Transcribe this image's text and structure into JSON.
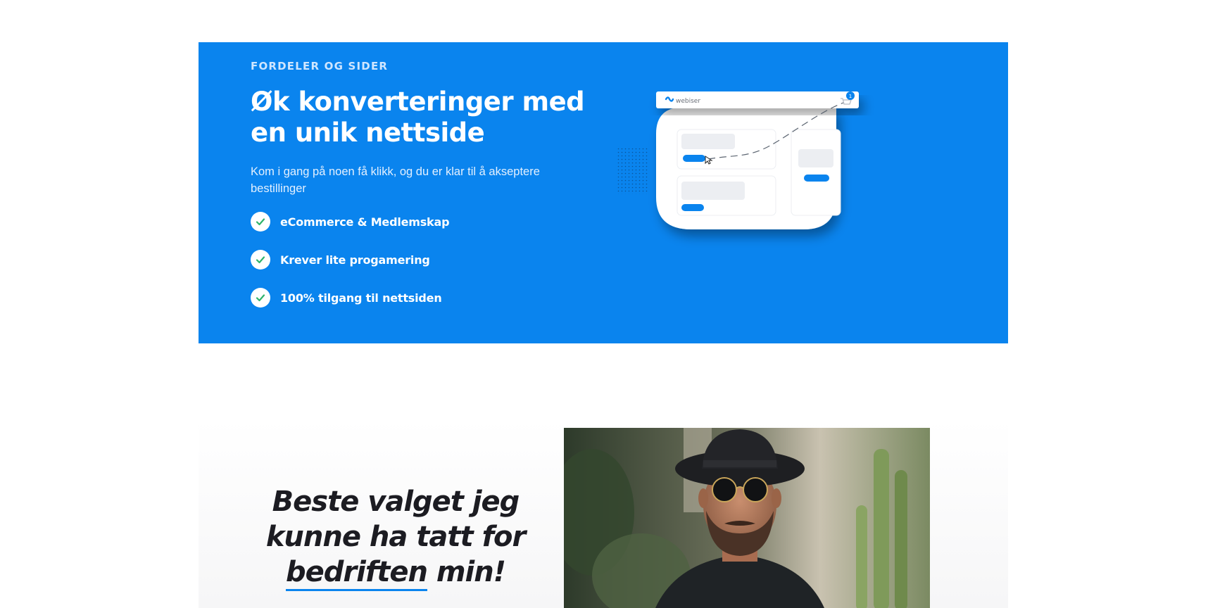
{
  "feature": {
    "eyebrow": "FORDELER OG SIDER",
    "headline": "Øk konverteringer med en unik nettside",
    "subtext": "Kom i gang på noen få klikk, og du er klar til å akseptere bestillinger",
    "benefits": [
      {
        "label": "eCommerce & Medlemskap",
        "icon": "check-icon"
      },
      {
        "label": "Krever lite progamering",
        "icon": "check-icon"
      },
      {
        "label": "100% tilgang til nettsiden",
        "icon": "check-icon"
      }
    ],
    "illustration": {
      "brand": "webiser",
      "notification_count": "1"
    }
  },
  "testimonial": {
    "quote_part1": "Beste valget jeg kunne ha tatt for ",
    "quote_underlined": "bedriften",
    "quote_part2": " min!",
    "photo": "portrait-man-hat-sunglasses"
  },
  "colors": {
    "primary_blue": "#0a84ee",
    "check_green": "#2fb36b",
    "quote_text": "#1c1c22"
  }
}
